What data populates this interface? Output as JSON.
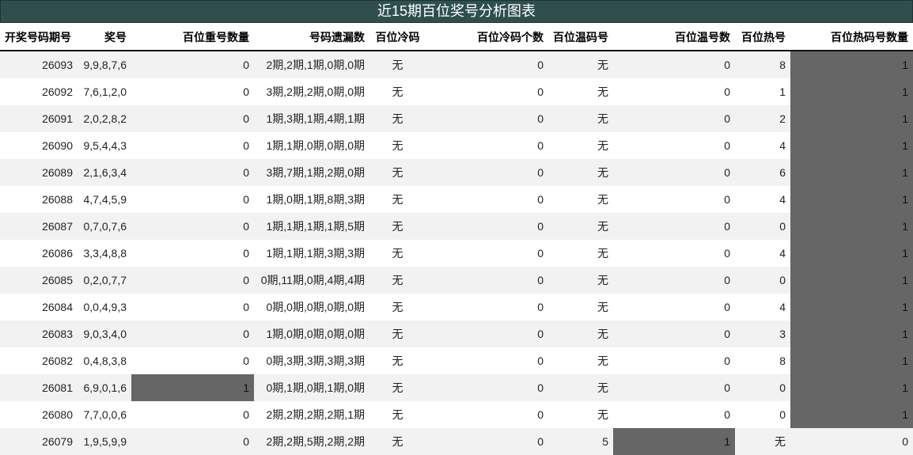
{
  "title": "近15期百位奖号分析图表",
  "columns": [
    "开奖号码期号",
    "奖号",
    "百位重号数量",
    "号码遗漏数",
    "百位冷码",
    "百位冷码个数",
    "百位温码号",
    "百位温号数",
    "百位热号",
    "百位热码号数量"
  ],
  "highlight_color": "#666666",
  "rows": [
    {
      "period": "26093",
      "numbers": "9,9,8,7,6",
      "repeat_count": "0",
      "miss": "2期,2期,1期,0期,0期",
      "cold": "无",
      "cold_count": "0",
      "warm": "无",
      "warm_count": "0",
      "hot": "8",
      "hot_count": "1",
      "hl_repeat": false,
      "hl_warm_count": false,
      "hl_hot_count": true
    },
    {
      "period": "26092",
      "numbers": "7,6,1,2,0",
      "repeat_count": "0",
      "miss": "3期,2期,2期,0期,0期",
      "cold": "无",
      "cold_count": "0",
      "warm": "无",
      "warm_count": "0",
      "hot": "1",
      "hot_count": "1",
      "hl_repeat": false,
      "hl_warm_count": false,
      "hl_hot_count": true
    },
    {
      "period": "26091",
      "numbers": "2,0,2,8,2",
      "repeat_count": "0",
      "miss": "1期,3期,1期,4期,1期",
      "cold": "无",
      "cold_count": "0",
      "warm": "无",
      "warm_count": "0",
      "hot": "2",
      "hot_count": "1",
      "hl_repeat": false,
      "hl_warm_count": false,
      "hl_hot_count": true
    },
    {
      "period": "26090",
      "numbers": "9,5,4,4,3",
      "repeat_count": "0",
      "miss": "1期,1期,0期,0期,0期",
      "cold": "无",
      "cold_count": "0",
      "warm": "无",
      "warm_count": "0",
      "hot": "4",
      "hot_count": "1",
      "hl_repeat": false,
      "hl_warm_count": false,
      "hl_hot_count": true
    },
    {
      "period": "26089",
      "numbers": "2,1,6,3,4",
      "repeat_count": "0",
      "miss": "3期,7期,1期,2期,0期",
      "cold": "无",
      "cold_count": "0",
      "warm": "无",
      "warm_count": "0",
      "hot": "6",
      "hot_count": "1",
      "hl_repeat": false,
      "hl_warm_count": false,
      "hl_hot_count": true
    },
    {
      "period": "26088",
      "numbers": "4,7,4,5,9",
      "repeat_count": "0",
      "miss": "1期,0期,1期,8期,3期",
      "cold": "无",
      "cold_count": "0",
      "warm": "无",
      "warm_count": "0",
      "hot": "4",
      "hot_count": "1",
      "hl_repeat": false,
      "hl_warm_count": false,
      "hl_hot_count": true
    },
    {
      "period": "26087",
      "numbers": "0,7,0,7,6",
      "repeat_count": "0",
      "miss": "1期,1期,1期,1期,5期",
      "cold": "无",
      "cold_count": "0",
      "warm": "无",
      "warm_count": "0",
      "hot": "0",
      "hot_count": "1",
      "hl_repeat": false,
      "hl_warm_count": false,
      "hl_hot_count": true
    },
    {
      "period": "26086",
      "numbers": "3,3,4,8,8",
      "repeat_count": "0",
      "miss": "1期,1期,1期,3期,3期",
      "cold": "无",
      "cold_count": "0",
      "warm": "无",
      "warm_count": "0",
      "hot": "4",
      "hot_count": "1",
      "hl_repeat": false,
      "hl_warm_count": false,
      "hl_hot_count": true
    },
    {
      "period": "26085",
      "numbers": "0,2,0,7,7",
      "repeat_count": "0",
      "miss": "0期,11期,0期,4期,4期",
      "cold": "无",
      "cold_count": "0",
      "warm": "无",
      "warm_count": "0",
      "hot": "0",
      "hot_count": "1",
      "hl_repeat": false,
      "hl_warm_count": false,
      "hl_hot_count": true
    },
    {
      "period": "26084",
      "numbers": "0,0,4,9,3",
      "repeat_count": "0",
      "miss": "0期,0期,0期,0期,0期",
      "cold": "无",
      "cold_count": "0",
      "warm": "无",
      "warm_count": "0",
      "hot": "4",
      "hot_count": "1",
      "hl_repeat": false,
      "hl_warm_count": false,
      "hl_hot_count": true
    },
    {
      "period": "26083",
      "numbers": "9,0,3,4,0",
      "repeat_count": "0",
      "miss": "1期,0期,0期,0期,0期",
      "cold": "无",
      "cold_count": "0",
      "warm": "无",
      "warm_count": "0",
      "hot": "3",
      "hot_count": "1",
      "hl_repeat": false,
      "hl_warm_count": false,
      "hl_hot_count": true
    },
    {
      "period": "26082",
      "numbers": "0,4,8,3,8",
      "repeat_count": "0",
      "miss": "0期,3期,3期,3期,3期",
      "cold": "无",
      "cold_count": "0",
      "warm": "无",
      "warm_count": "0",
      "hot": "8",
      "hot_count": "1",
      "hl_repeat": false,
      "hl_warm_count": false,
      "hl_hot_count": true
    },
    {
      "period": "26081",
      "numbers": "6,9,0,1,6",
      "repeat_count": "1",
      "miss": "0期,1期,0期,1期,0期",
      "cold": "无",
      "cold_count": "0",
      "warm": "无",
      "warm_count": "0",
      "hot": "0",
      "hot_count": "1",
      "hl_repeat": true,
      "hl_warm_count": false,
      "hl_hot_count": true
    },
    {
      "period": "26080",
      "numbers": "7,7,0,0,6",
      "repeat_count": "0",
      "miss": "2期,2期,2期,2期,1期",
      "cold": "无",
      "cold_count": "0",
      "warm": "无",
      "warm_count": "0",
      "hot": "0",
      "hot_count": "1",
      "hl_repeat": false,
      "hl_warm_count": false,
      "hl_hot_count": true
    },
    {
      "period": "26079",
      "numbers": "1,9,5,9,9",
      "repeat_count": "0",
      "miss": "2期,2期,5期,2期,2期",
      "cold": "无",
      "cold_count": "0",
      "warm": "5",
      "warm_count": "1",
      "hot": "无",
      "hot_count": "0",
      "hl_repeat": false,
      "hl_warm_count": true,
      "hl_hot_count": false
    }
  ]
}
